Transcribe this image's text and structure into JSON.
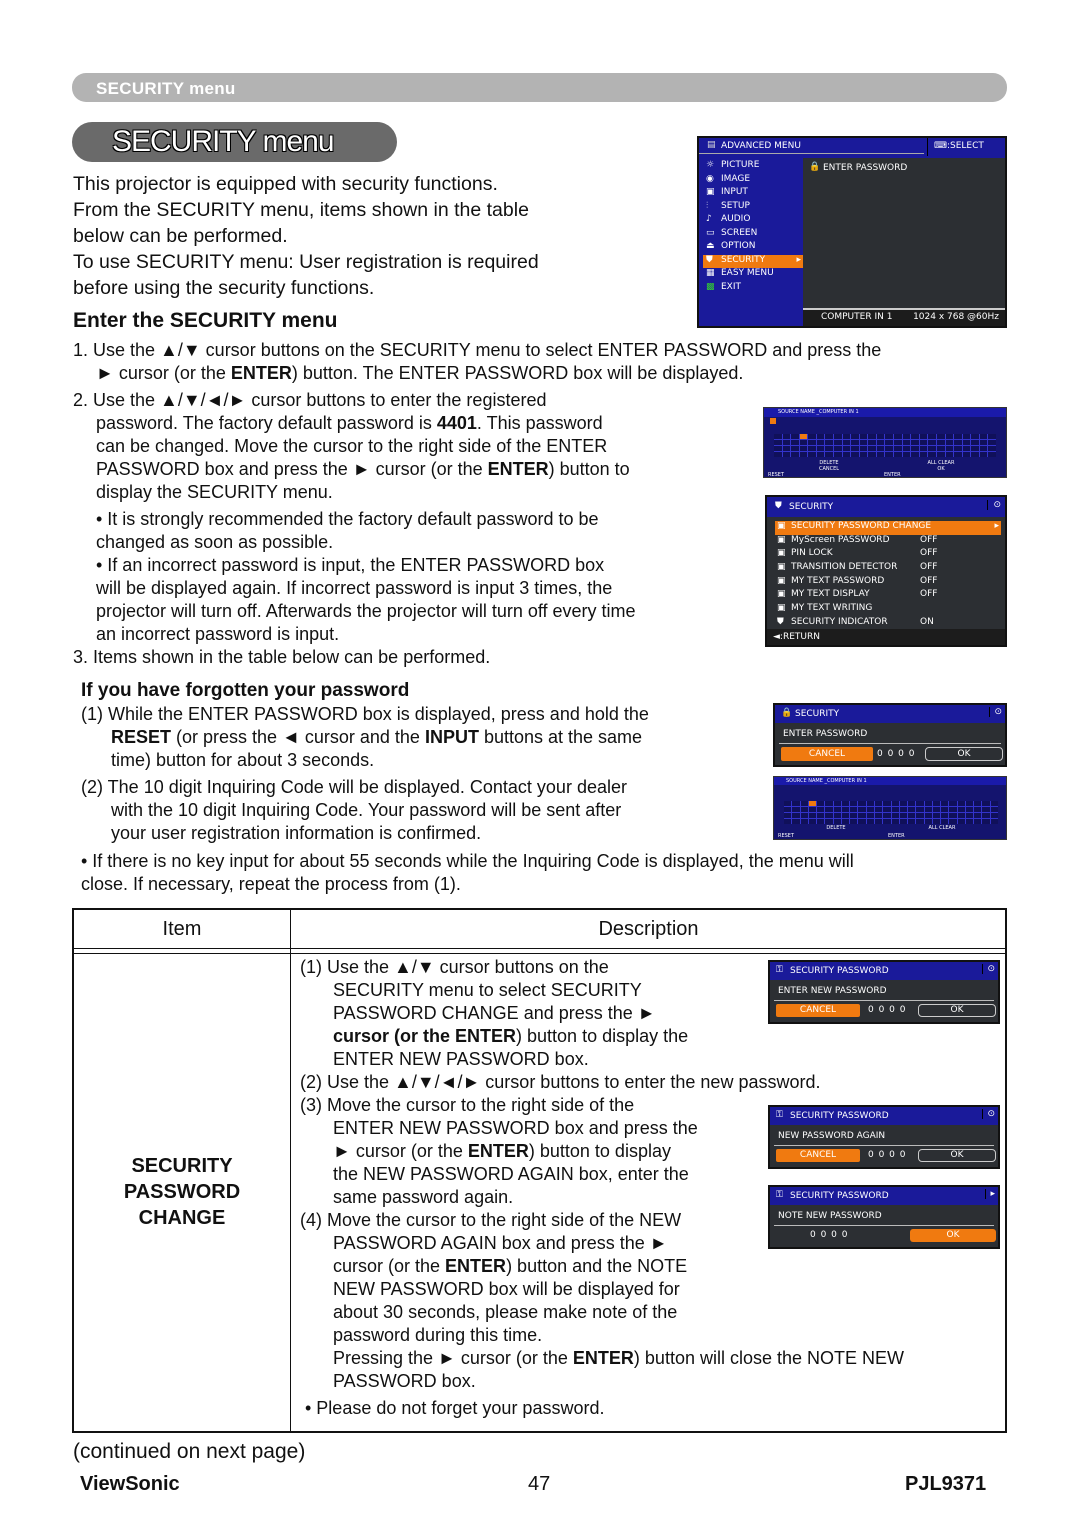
{
  "header_bar": {
    "label": "SECURITY menu"
  },
  "title": "SECURITY menu",
  "intro": [
    "This projector is equipped with security functions.",
    "From the SECURITY menu, items shown in the table",
    "below can be performed.",
    "To use SECURITY menu: User registration is required",
    "before using the security functions."
  ],
  "enter_heading": "Enter the SECURITY menu",
  "step1": {
    "line1": "1. Use the ▲/▼ cursor buttons on the SECURITY menu to select ENTER PASSWORD and press the",
    "line2_a": "► cursor (or the ",
    "line2_b": "ENTER",
    "line2_c": ") button. The ENTER PASSWORD box will be displayed."
  },
  "step2": {
    "l1": "2. Use the ▲/▼/◄/► cursor buttons to enter the registered",
    "l2_a": "password. The factory default password is ",
    "l2_b": "4401",
    "l2_c": ". This password",
    "l3": "can be changed. Move the cursor to the right side of the ENTER",
    "l4_a": "PASSWORD box and press the ► cursor (or the ",
    "l4_b": "ENTER",
    "l4_c": ") button to",
    "l5": "display the SECURITY menu."
  },
  "bullets": {
    "b1_l1": "• It is strongly recommended the factory default password to be",
    "b1_l2": "changed as soon as possible.",
    "b2_l1": "• If an incorrect password is input, the ENTER PASSWORD box",
    "b2_l2": "will be displayed again. If incorrect password is input 3 times, the",
    "b2_l3": "projector will turn off. Afterwards the projector will turn off every time",
    "b2_l4": "an incorrect password is input."
  },
  "step3": "3. Items shown in the table below can be performed.",
  "forgot": {
    "heading": "If you have forgotten your password",
    "p1_l1": "(1) While the ENTER PASSWORD box is displayed, press and hold the",
    "p1_l2_a": "RESET",
    "p1_l2_b": " (or press the ◄ cursor and the ",
    "p1_l2_c": "INPUT",
    "p1_l2_d": " buttons at the same",
    "p1_l3": "time) button for about 3 seconds.",
    "p2_l1": "(2) The 10 digit Inquiring Code will be displayed. Contact your dealer",
    "p2_l2": "with the 10 digit Inquiring Code. Your password will be sent after",
    "p2_l3": "your user registration information is confirmed.",
    "note_l1": "• If there is no key input for about 55 seconds while the Inquiring Code is displayed, the menu will",
    "note_l2": "close. If necessary, repeat the process from (1)."
  },
  "table": {
    "headers": [
      "Item",
      "Description"
    ],
    "item": [
      "SECURITY",
      "PASSWORD",
      "CHANGE"
    ],
    "d1_l1": "(1) Use the ▲/▼ cursor buttons on the",
    "d1_l2": "SECURITY menu to select SECURITY",
    "d1_l3": "PASSWORD CHANGE and press the ►",
    "d1_l4_a": "cursor (or the ENTER",
    "d1_l4_b": ") button to display the",
    "d1_l5": "ENTER NEW PASSWORD box.",
    "d2": "(2) Use the ▲/▼/◄/► cursor buttons to enter the new password.",
    "d3_l1": "(3) Move the cursor to the right side of the",
    "d3_l2": "ENTER NEW PASSWORD box and press the",
    "d3_l3_a": "► cursor (or the ",
    "d3_l3_b": "ENTER",
    "d3_l3_c": ") button to display",
    "d3_l4": "the NEW PASSWORD AGAIN box, enter the",
    "d3_l5": "same password again.",
    "d4_l1": "(4) Move the cursor to the right side of the NEW",
    "d4_l2": "PASSWORD AGAIN box and press the ►",
    "d4_l3_a": "cursor (or the ",
    "d4_l3_b": "ENTER",
    "d4_l3_c": ") button and the NOTE",
    "d4_l4": "NEW PASSWORD box will be displayed for",
    "d4_l5": "about 30 seconds, please make note of the",
    "d4_l6": "password during this time.",
    "d4_l7_a": "Pressing the ► cursor (or the ",
    "d4_l7_b": "ENTER",
    "d4_l7_c": ") button will close the NOTE NEW",
    "d4_l8": "PASSWORD box.",
    "d5": "• Please do not forget your password."
  },
  "continued": "(continued on next page)",
  "footer": {
    "brand": "ViewSonic",
    "page": "47",
    "model": "PJL9371"
  },
  "osd_advanced": {
    "title": "ADVANCED MENU",
    "select": "⌨:SELECT",
    "items": [
      "PICTURE",
      "IMAGE",
      "INPUT",
      "SETUP",
      "AUDIO",
      "SCREEN",
      "OPTION",
      "SECURITY",
      "EASY MENU",
      "EXIT"
    ],
    "selected": "SECURITY",
    "right_item": "ENTER PASSWORD",
    "status_source": "COMPUTER IN 1",
    "status_signal": "1024 x 768 @60Hz",
    "colors": {
      "blue": "#1a1a9a",
      "orange": "#f07a10",
      "panel": "#2c2f33"
    }
  },
  "osd_security": {
    "title": "SECURITY",
    "rows": [
      {
        "label": "SECURITY PASSWORD CHANGE",
        "value": ""
      },
      {
        "label": "MyScreen PASSWORD",
        "value": "OFF"
      },
      {
        "label": "PIN LOCK",
        "value": "OFF"
      },
      {
        "label": "TRANSITION DETECTOR",
        "value": "OFF"
      },
      {
        "label": "MY TEXT PASSWORD",
        "value": "OFF"
      },
      {
        "label": "MY TEXT DISPLAY",
        "value": "OFF"
      },
      {
        "label": "MY TEXT WRITING",
        "value": ""
      },
      {
        "label": "SECURITY INDICATOR",
        "value": "ON"
      }
    ],
    "return": "◄:RETURN"
  },
  "osd_enter_pw": {
    "title": "SECURITY",
    "label": "ENTER PASSWORD",
    "cancel": "CANCEL",
    "digits": "0 0 0 0",
    "ok": "OK"
  },
  "osd_new_pw": {
    "title": "SECURITY PASSWORD",
    "label": "ENTER NEW PASSWORD",
    "cancel": "CANCEL",
    "digits": "0 0 0 0",
    "ok": "OK"
  },
  "osd_again_pw": {
    "title": "SECURITY PASSWORD",
    "label": "NEW PASSWORD AGAIN",
    "cancel": "CANCEL",
    "digits": "0 0 0 0",
    "ok": "OK"
  },
  "osd_note_pw": {
    "title": "SECURITY PASSWORD",
    "label": "NOTE NEW PASSWORD",
    "digits": "0 0 0 0",
    "ok": "OK"
  },
  "osd_keyboard": {
    "title": "SOURCE NAME _COMPUTER IN 1",
    "delete": "DELETE",
    "all_clear": "ALL CLEAR",
    "cancel": "CANCEL",
    "ok": "OK",
    "reset": "RESET",
    "enter": "ENTER"
  }
}
